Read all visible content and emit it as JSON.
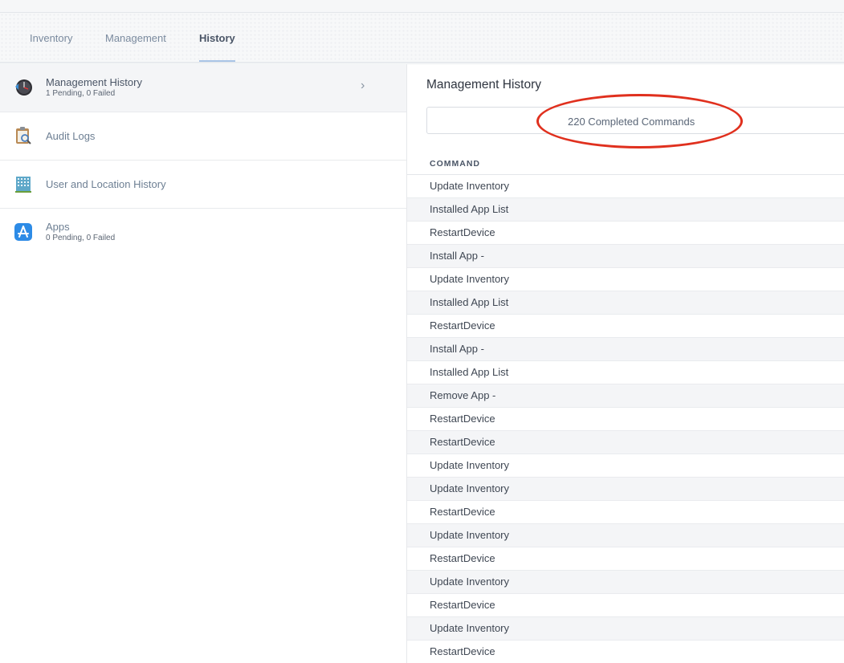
{
  "tabs": [
    "Inventory",
    "Management",
    "History"
  ],
  "sidebar": {
    "items": [
      {
        "label": "Management History",
        "sub": "1 Pending, 0 Failed",
        "icon": "time-machine-icon",
        "chevron": "›"
      },
      {
        "label": "Audit Logs",
        "icon": "clipboard-magnifier-icon"
      },
      {
        "label": "User and Location History",
        "icon": "building-icon"
      },
      {
        "label": "Apps",
        "sub": "0 Pending, 0 Failed",
        "icon": "app-store-icon"
      }
    ]
  },
  "main": {
    "title": "Management History",
    "completed_label": "220 Completed Commands",
    "column_header": "COMMAND",
    "rows": [
      "Update Inventory",
      "Installed App List",
      "RestartDevice",
      "Install App -",
      "Update Inventory",
      "Installed App List",
      "RestartDevice",
      "Install App -",
      "Installed App List",
      "Remove App -",
      "RestartDevice",
      "RestartDevice",
      "Update Inventory",
      "Update Inventory",
      "RestartDevice",
      "Update Inventory",
      "RestartDevice",
      "Update Inventory",
      "RestartDevice",
      "Update Inventory",
      "RestartDevice"
    ]
  },
  "colors": {
    "highlight_ellipse": "#e0301e",
    "tab_underline": "#a9c4e6"
  }
}
